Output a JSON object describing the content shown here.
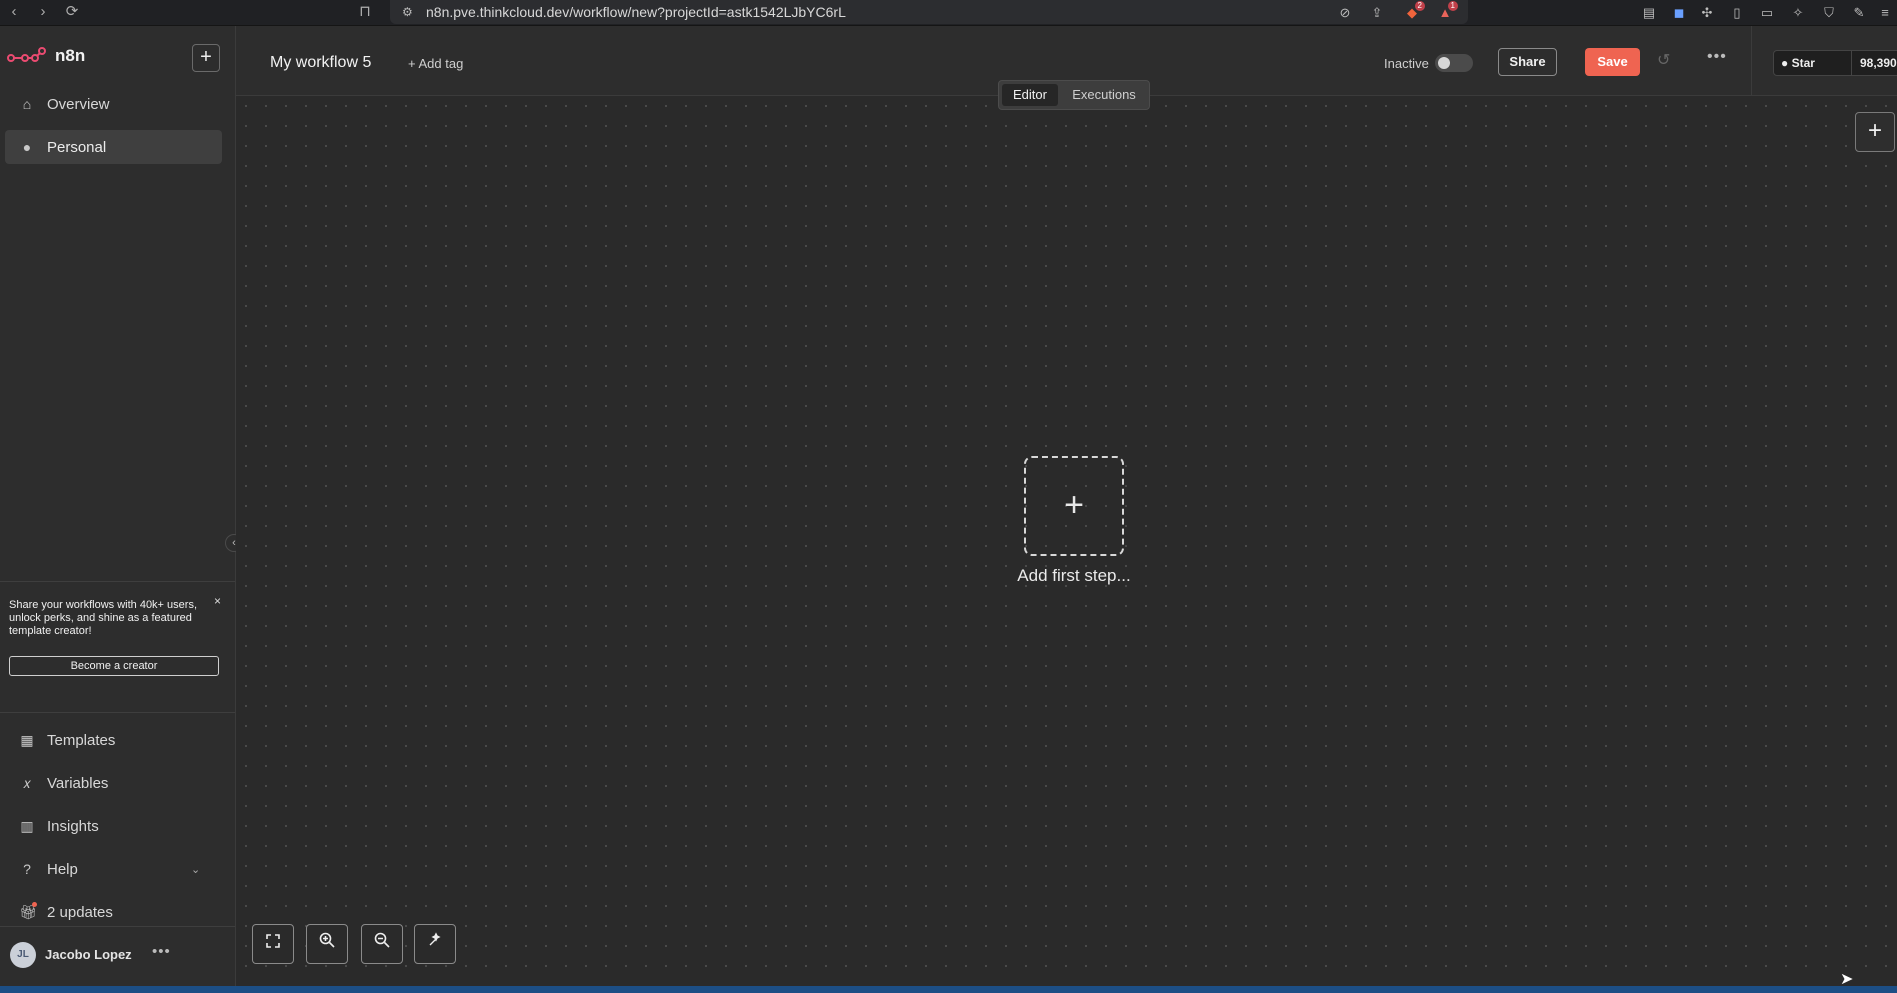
{
  "browser": {
    "url": "n8n.pve.thinkcloud.dev/workflow/new?projectId=astk1542LJbYC6rL",
    "back_icon": "chevron-left",
    "forward_icon": "chevron-right",
    "reload_icon": "reload",
    "bookmark_icon": "bookmark",
    "extension_badges": [
      "2",
      "1"
    ]
  },
  "sidebar": {
    "brand": "n8n",
    "nav_items": [
      {
        "label": "Overview",
        "icon": "home"
      },
      {
        "label": "Personal",
        "icon": "user",
        "active": true
      }
    ],
    "promo": {
      "text": "Share your workflows with 40k+ users, unlock perks, and shine as a featured template creator!",
      "close": "×",
      "button": "Become a creator"
    },
    "bottom_items": [
      {
        "label": "Templates",
        "icon": "templates"
      },
      {
        "label": "Variables",
        "icon": "variables"
      },
      {
        "label": "Insights",
        "icon": "chart"
      },
      {
        "label": "Help",
        "icon": "question"
      },
      {
        "label": "2 updates",
        "icon": "gift"
      }
    ],
    "user": {
      "initials": "JL",
      "name": "Jacobo Lopez",
      "more": "•••"
    }
  },
  "header": {
    "workflow_name": "My workflow 5",
    "add_tag": "+ Add tag",
    "status": "Inactive",
    "active": false,
    "share": "Share",
    "save": "Save",
    "more": "•••",
    "github_star": "Star",
    "github_count": "98,390"
  },
  "tabs": [
    {
      "label": "Editor",
      "active": true
    },
    {
      "label": "Executions",
      "active": false
    }
  ],
  "canvas": {
    "add_first_step_icon": "+",
    "add_first_step_label": "Add first step...",
    "add_node_icon": "+"
  },
  "colors": {
    "accent": "#ef6451",
    "background": "#2a2a2a",
    "sidebar": "#2d2d2d"
  }
}
